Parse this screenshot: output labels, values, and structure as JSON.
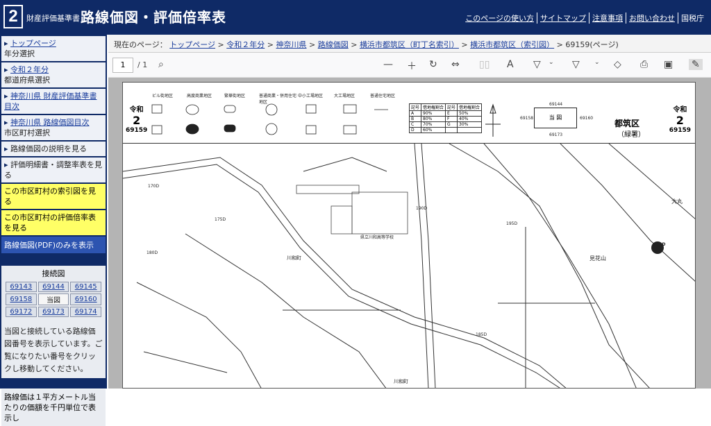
{
  "header": {
    "logo": "2",
    "subtitle": "財産評価基準書",
    "title": "路線価図・評価倍率表",
    "links": [
      "このページの使い方",
      "サイトマップ",
      "注意事項",
      "お問い合わせ",
      "国税庁"
    ]
  },
  "sidebar": {
    "top_link": "トップページ",
    "top_sub": "年分選択",
    "year_link": "令和２年分",
    "year_sub": "都道府県選択",
    "pref_link": "神奈川県 財産評価基準書目次",
    "route_link": "神奈川県 路線価図目次",
    "route_sub": "市区町村選択",
    "item1": "路線価図の説明を見る",
    "item2": "評価明細書・調整率表を見る",
    "yellow1": "この市区町村の索引図を見る",
    "yellow2": "この市区町村の評価倍率表を見る",
    "pdfonly": "路線価図(PDF)のみを表示",
    "conn_title": "接続図",
    "conn": [
      [
        "69143",
        "69144",
        "69145"
      ],
      [
        "69158",
        "当図",
        "69160"
      ],
      [
        "69172",
        "69173",
        "69174"
      ]
    ],
    "conn_text": "当図と接続している路線価図番号を表示しています。ご覧になりたい番号をクリックし移動してください。",
    "bottom": "路線価は１平方メートル当たりの価額を千円単位で表示し"
  },
  "breadcrumb": {
    "prefix": "現在のページ：",
    "items": [
      "トップページ",
      "令和２年分",
      "神奈川県",
      "路線価図",
      "横浜市都筑区（町丁名索引）",
      "横浜市都筑区（索引図）"
    ],
    "current": "69159(ページ)"
  },
  "toolbar": {
    "page": "1",
    "total": "/ 1"
  },
  "map": {
    "era": "令和",
    "num": "2",
    "code": "69159",
    "district": "都筑区",
    "office": "（緑署）",
    "center": "当 図",
    "nb_top": "69144",
    "nb_left": "69158",
    "nb_right": "69160",
    "nb_bottom": "69173",
    "legend": [
      "ビル街地区",
      "高度商業地区",
      "繁華街地区",
      "普通商業・併用住宅地区",
      "中小工場地区",
      "大工場地区",
      "普通住宅地区"
    ],
    "rates": [
      [
        "記号",
        "借地権割合",
        "記号",
        "借地権割合"
      ],
      [
        "A",
        "90%",
        "E",
        "50%"
      ],
      [
        "B",
        "80%",
        "F",
        "40%"
      ],
      [
        "C",
        "70%",
        "G",
        "30%"
      ],
      [
        "D",
        "60%",
        "",
        ""
      ]
    ],
    "places": [
      "川和町",
      "見花山",
      "大丸",
      "川和町",
      "県立川和高等学校"
    ],
    "prices": [
      "170D",
      "175D",
      "180D",
      "190D",
      "195D",
      "185D",
      "260D"
    ]
  }
}
